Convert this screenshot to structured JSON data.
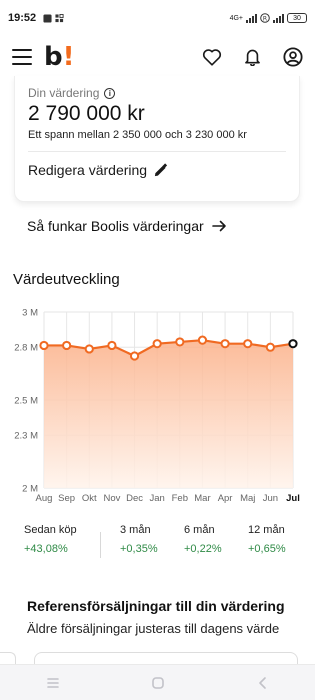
{
  "status": {
    "time": "19:52",
    "network": "4G+",
    "battery": "30"
  },
  "app": {
    "brand": "b",
    "brand_mark": "!"
  },
  "valuation": {
    "label": "Din värdering",
    "value": "2 790 000 kr",
    "range": "Ett spann mellan 2 350 000 och 3 230 000 kr",
    "edit_label": "Redigera värdering"
  },
  "how_link": "Så funkar Boolis värderingar",
  "chart_section_title": "Värdeutveckling",
  "chart_data": {
    "type": "area",
    "categories": [
      "Aug",
      "Sep",
      "Okt",
      "Nov",
      "Dec",
      "Jan",
      "Feb",
      "Mar",
      "Apr",
      "Maj",
      "Jun",
      "Jul"
    ],
    "series": [
      {
        "values": [
          2.81,
          2.81,
          2.79,
          2.81,
          2.75,
          2.82,
          2.83,
          2.84,
          2.82,
          2.82,
          2.8,
          2.82
        ]
      }
    ],
    "ylim": [
      2.0,
      3.0
    ],
    "yticks": [
      "3 M",
      "2.8 M",
      "2.5 M",
      "2.3 M",
      "2 M"
    ],
    "ytick_values": [
      3.0,
      2.8,
      2.5,
      2.3,
      2.0
    ],
    "highlight": "Jul",
    "colors": {
      "line": "#f06a22",
      "fill_top": "#fbb088",
      "fill_bottom": "#fff3eb",
      "grid": "#e6e6e6"
    },
    "grid": true
  },
  "stats": [
    {
      "label": "Sedan köp",
      "value": "+43,08%"
    },
    {
      "label": "3 mån",
      "value": "+0,35%"
    },
    {
      "label": "6 mån",
      "value": "+0,22%"
    },
    {
      "label": "12 mån",
      "value": "+0,65%"
    }
  ],
  "references": {
    "title": "Referensförsäljningar till din värdering",
    "subtitle": "Äldre försäljningar justeras till dagens värde"
  },
  "colors": {
    "accent": "#f26b1d",
    "positive": "#2f8a46"
  }
}
